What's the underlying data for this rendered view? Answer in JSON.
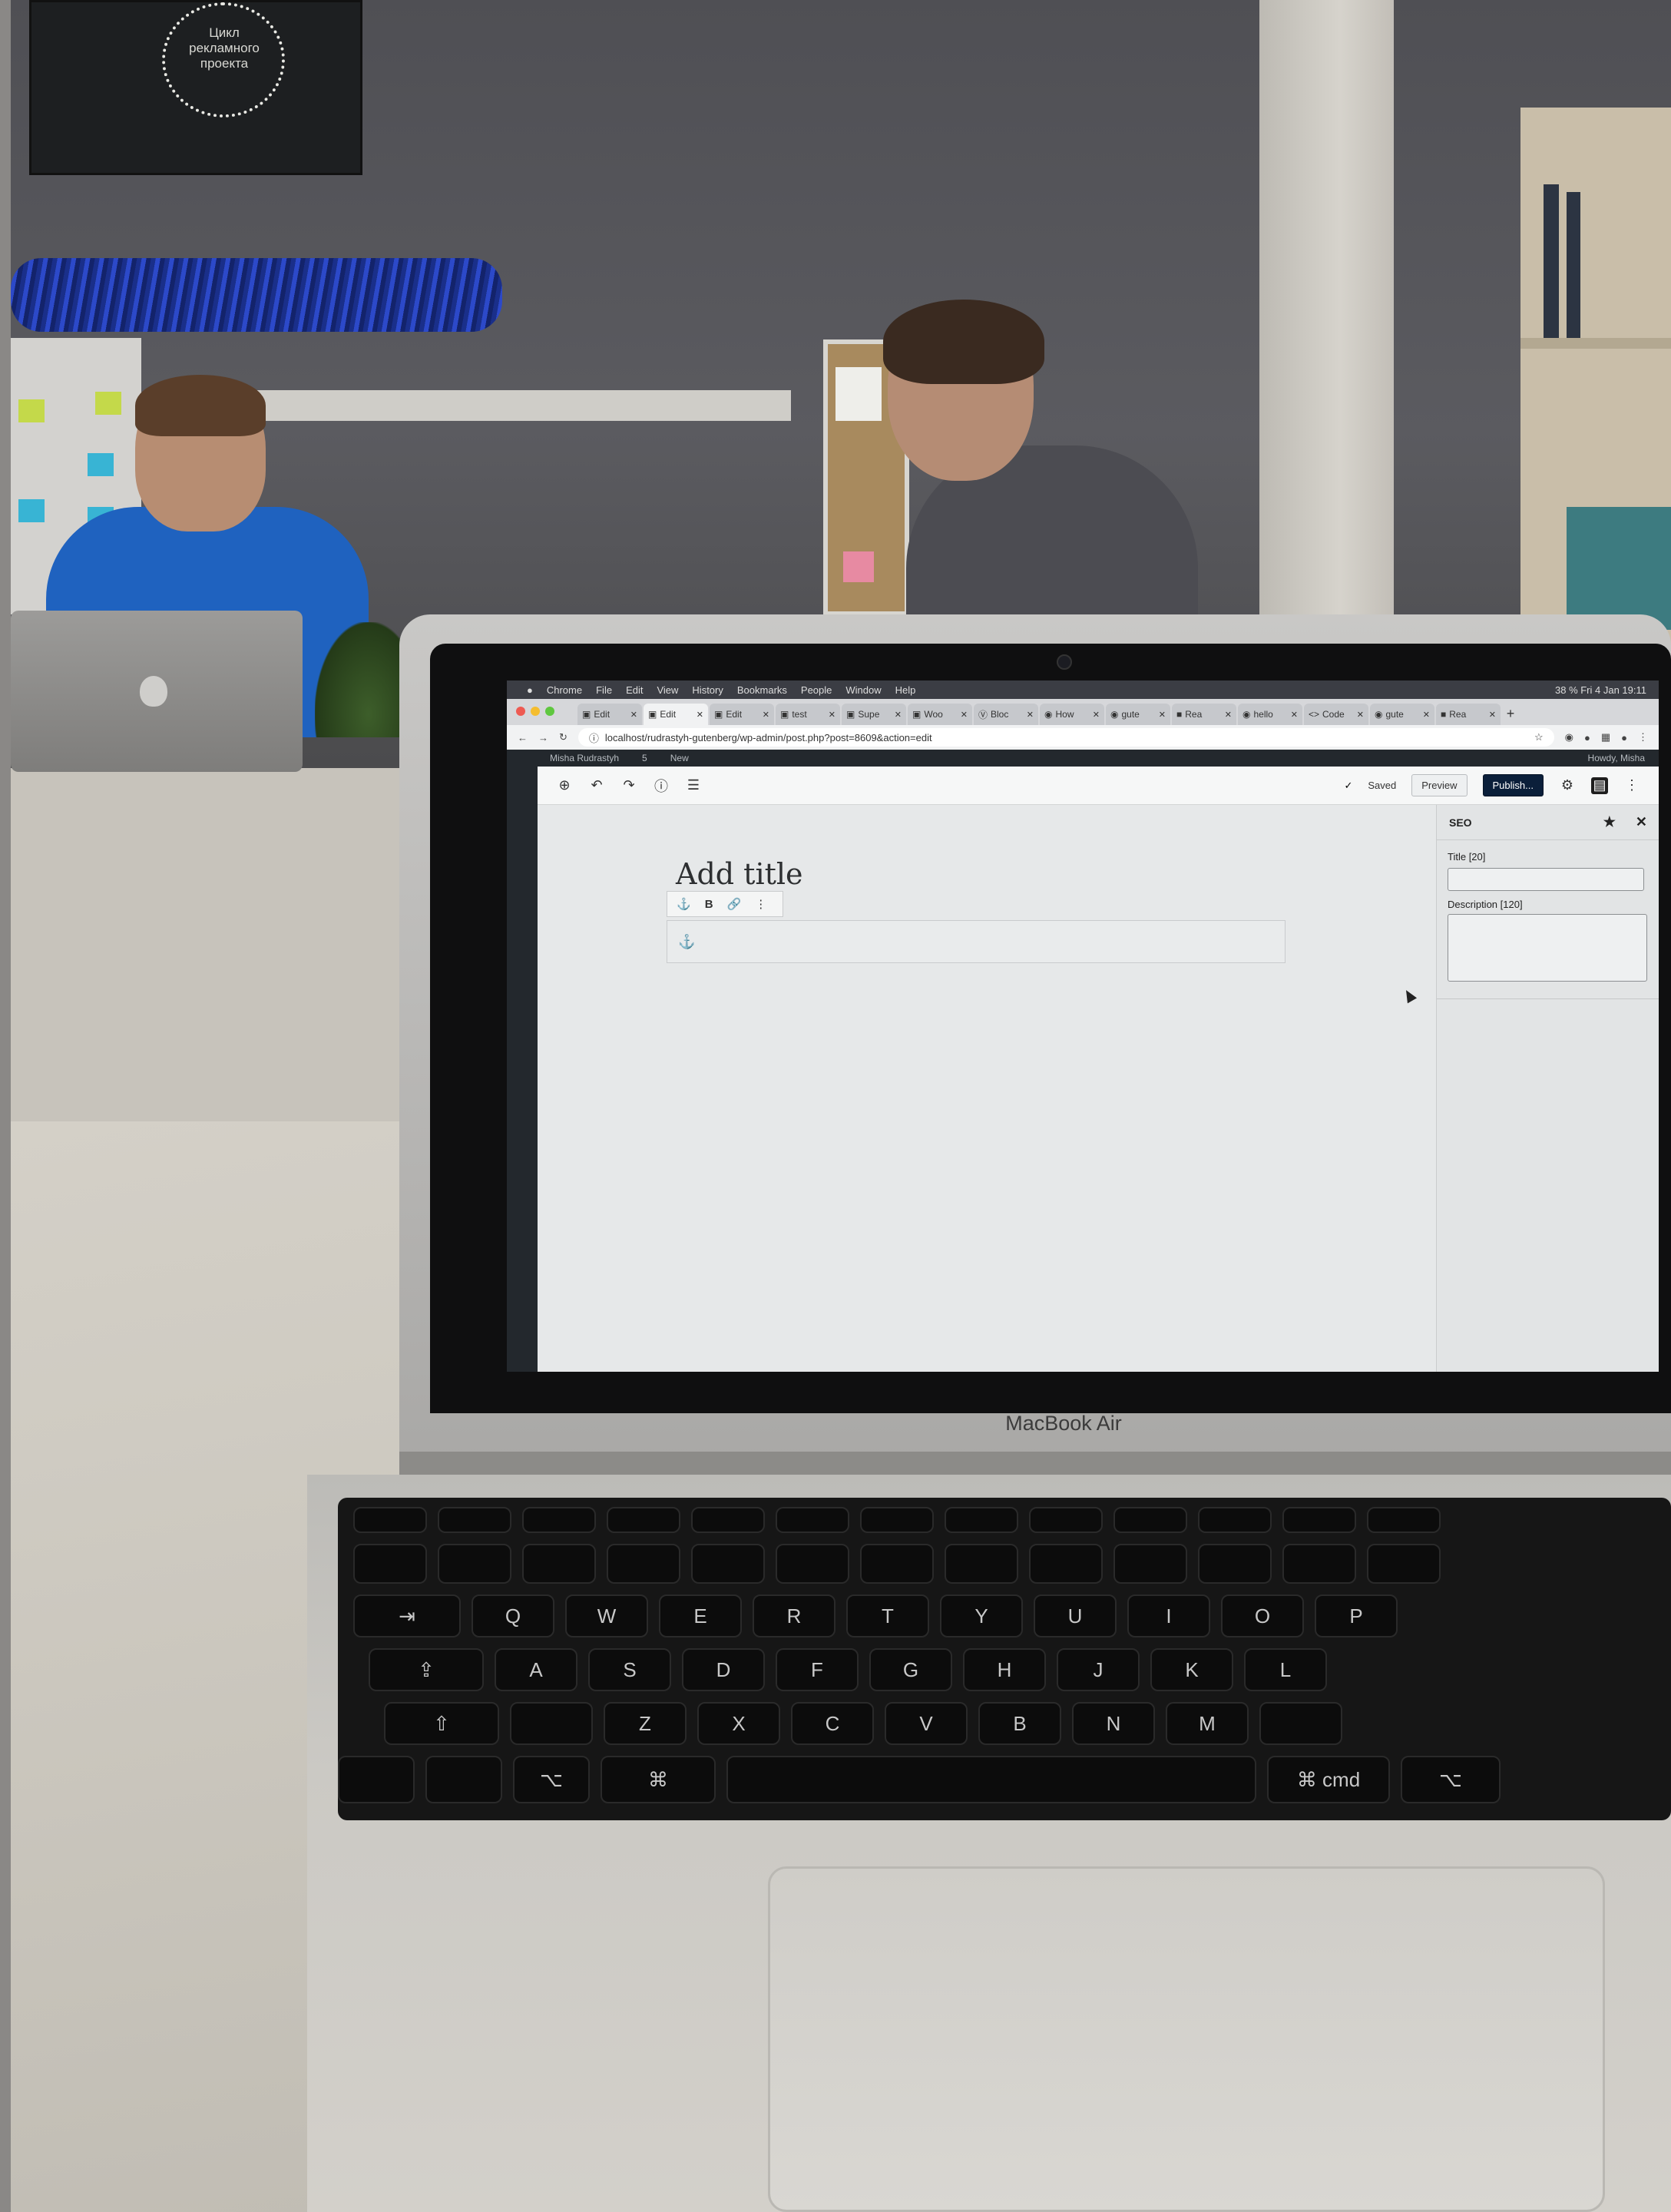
{
  "poster": {
    "text": "Цикл рекламного проекта"
  },
  "laptop": {
    "brand": "MacBook Air"
  },
  "macos_menubar": {
    "items": [
      "Chrome",
      "File",
      "Edit",
      "View",
      "History",
      "Bookmarks",
      "People",
      "Window",
      "Help"
    ],
    "status": "38 %  Fri 4 Jan 19:11"
  },
  "browser": {
    "tabs": [
      {
        "label": "Edit"
      },
      {
        "label": "Edit",
        "active": true
      },
      {
        "label": "Edit"
      },
      {
        "label": "test"
      },
      {
        "label": "Supe"
      },
      {
        "label": "Woo"
      },
      {
        "label": "Bloc"
      },
      {
        "label": "How"
      },
      {
        "label": "gute"
      },
      {
        "label": "Rea"
      },
      {
        "label": "hello"
      },
      {
        "label": "Code"
      },
      {
        "label": "gute"
      },
      {
        "label": "Rea"
      }
    ],
    "url": "localhost/rudrastyh-gutenberg/wp-admin/post.php?post=8609&action=edit"
  },
  "wp_adminbar": {
    "site": "Misha Rudrastyh",
    "comments": "5",
    "new": "New",
    "howdy": "Howdy, Misha"
  },
  "editor": {
    "saved": "Saved",
    "preview": "Preview",
    "publish": "Publish...",
    "title_placeholder": "Add title",
    "block_toolbar": {
      "bold": "B"
    }
  },
  "seo_panel": {
    "heading": "SEO",
    "title_label": "Title [20]",
    "description_label": "Description [120]"
  },
  "keyboard": {
    "row1": [
      "Q",
      "W",
      "E",
      "R",
      "T",
      "Y",
      "U",
      "I",
      "O",
      "P"
    ],
    "row2": [
      "A",
      "S",
      "D",
      "F",
      "G",
      "H",
      "J",
      "K",
      "L"
    ],
    "row3": [
      "Z",
      "X",
      "C",
      "V",
      "B",
      "N",
      "M"
    ],
    "cmd": "cmd"
  }
}
